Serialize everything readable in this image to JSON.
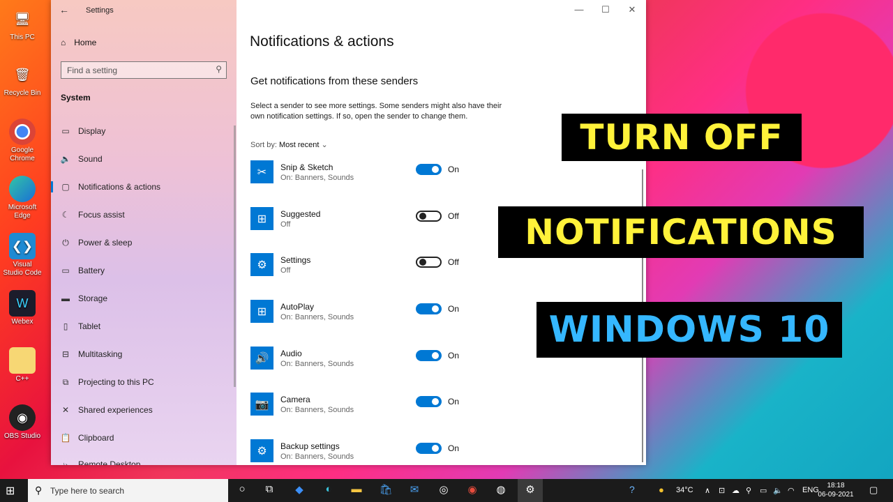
{
  "desktop": {
    "icons": [
      {
        "label": "This PC",
        "icon": "pc-icon"
      },
      {
        "label": "Recycle Bin",
        "icon": "recycle-bin-icon"
      },
      {
        "label": "Google Chrome",
        "icon": "chrome-icon"
      },
      {
        "label": "Microsoft Edge",
        "icon": "edge-icon"
      },
      {
        "label": "Visual Studio Code",
        "icon": "vscode-icon"
      },
      {
        "label": "Webex",
        "icon": "webex-icon"
      },
      {
        "label": "C++",
        "icon": "folder-icon"
      },
      {
        "label": "OBS Studio",
        "icon": "obs-icon"
      }
    ]
  },
  "window": {
    "title": "Settings",
    "home": "Home",
    "search_placeholder": "Find a setting",
    "section": "System",
    "nav": [
      {
        "label": "Display",
        "icon": "display-icon"
      },
      {
        "label": "Sound",
        "icon": "sound-icon"
      },
      {
        "label": "Notifications & actions",
        "icon": "notifications-icon",
        "selected": true
      },
      {
        "label": "Focus assist",
        "icon": "focus-assist-icon"
      },
      {
        "label": "Power & sleep",
        "icon": "power-icon"
      },
      {
        "label": "Battery",
        "icon": "battery-icon"
      },
      {
        "label": "Storage",
        "icon": "storage-icon"
      },
      {
        "label": "Tablet",
        "icon": "tablet-icon"
      },
      {
        "label": "Multitasking",
        "icon": "multitasking-icon"
      },
      {
        "label": "Projecting to this PC",
        "icon": "projecting-icon"
      },
      {
        "label": "Shared experiences",
        "icon": "shared-experiences-icon"
      },
      {
        "label": "Clipboard",
        "icon": "clipboard-icon"
      },
      {
        "label": "Remote Desktop",
        "icon": "remote-desktop-icon"
      }
    ]
  },
  "main": {
    "title": "Notifications & actions",
    "subtitle": "Get notifications from these senders",
    "description": "Select a sender to see more settings. Some senders might also have their own notification settings. If so, open the sender to change them.",
    "sort_label": "Sort by:",
    "sort_value": "Most recent",
    "senders": [
      {
        "name": "Snip & Sketch",
        "detail": "On: Banners, Sounds",
        "state": "On",
        "on": true,
        "icon": "snip-sketch-icon"
      },
      {
        "name": "Suggested",
        "detail": "Off",
        "state": "Off",
        "on": false,
        "icon": "suggested-icon"
      },
      {
        "name": "Settings",
        "detail": "Off",
        "state": "Off",
        "on": false,
        "icon": "settings-gear-icon"
      },
      {
        "name": "AutoPlay",
        "detail": "On: Banners, Sounds",
        "state": "On",
        "on": true,
        "icon": "autoplay-icon"
      },
      {
        "name": "Audio",
        "detail": "On: Banners, Sounds",
        "state": "On",
        "on": true,
        "icon": "audio-icon"
      },
      {
        "name": "Camera",
        "detail": "On: Banners, Sounds",
        "state": "On",
        "on": true,
        "icon": "camera-icon"
      },
      {
        "name": "Backup settings",
        "detail": "On: Banners, Sounds",
        "state": "On",
        "on": true,
        "icon": "backup-icon"
      }
    ]
  },
  "overlay": {
    "line1": "TURN OFF",
    "line2": "NOTIFICATIONS",
    "line3": "WINDOWS 10"
  },
  "taskbar": {
    "search_placeholder": "Type here to search",
    "temperature": "34°C",
    "language": "ENG",
    "time": "18:18",
    "date": "06-09-2021"
  }
}
